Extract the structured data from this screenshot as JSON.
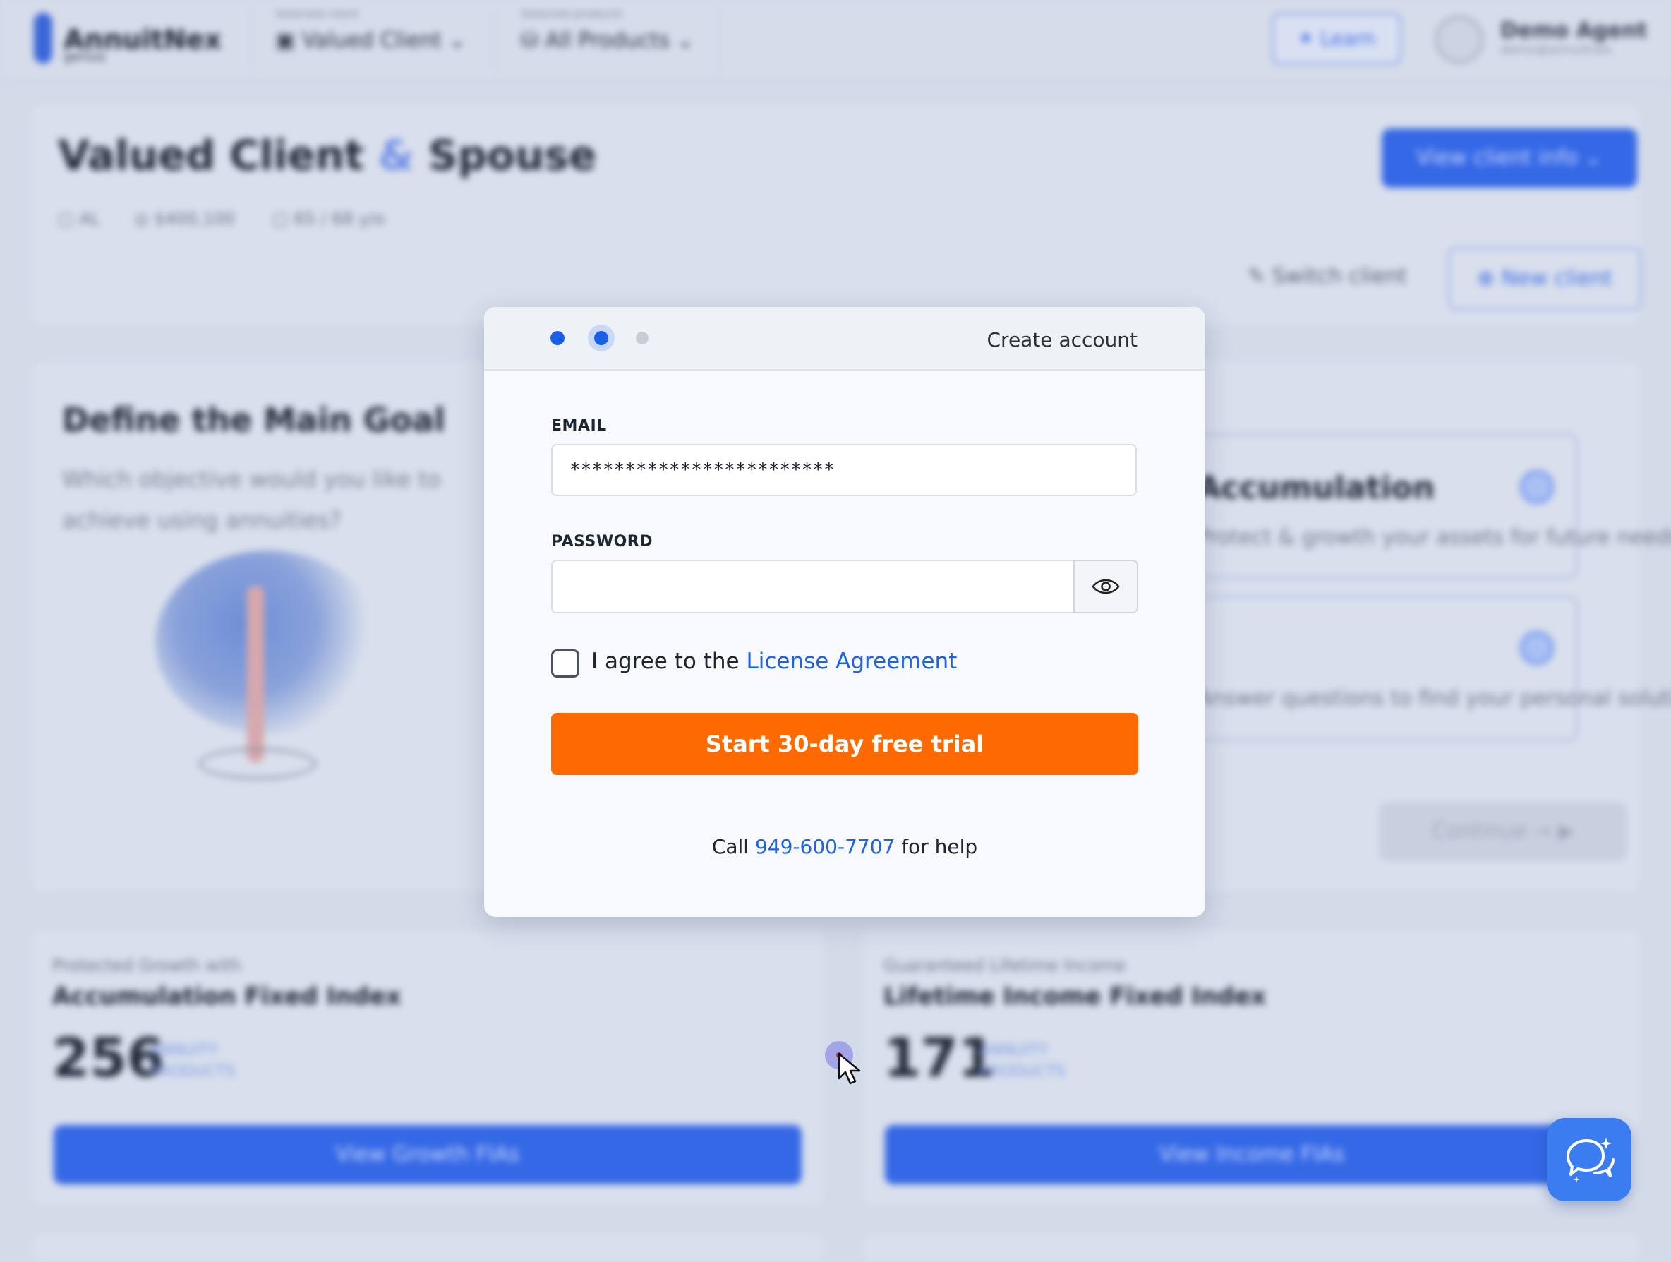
{
  "background": {
    "topbar": {
      "logo_text": "AnnuitNex",
      "logo_sub": "genius",
      "client_label": "Selected client",
      "client_value": "Valued Client",
      "product_label": "Selected products",
      "product_value": "All Products",
      "learn_label": "Learn",
      "agent_name": "Demo Agent",
      "agent_sub": "demo@annuitnex"
    },
    "client": {
      "name_first": "Valued Client",
      "name_amp": "&",
      "name_second": "Spouse",
      "state": "AL",
      "assets": "$400,100",
      "age": "65 / 68 y/o",
      "view_info_label": "View client info",
      "switch_label": "Switch client",
      "new_label": "New client"
    },
    "goal": {
      "title": "Define the Main Goal",
      "subtitle": "Which objective would you like to achieve using annuities?",
      "option1_title": "Accumulation",
      "option1_text": "Protect & growth your assets for future needs",
      "option2_text": "Answer questions to find your personal solution",
      "continue_label": "Continue"
    },
    "stats": [
      {
        "eyebrow": "Protected Growth with",
        "title": "Accumulation Fixed Index",
        "count": "256",
        "unit_line1": "ANNUITY",
        "unit_line2": "PRODUCTS",
        "button": "View Growth FIAs"
      },
      {
        "eyebrow": "Guaranteed Lifetime Income",
        "title": "Lifetime Income Fixed Index",
        "count": "171",
        "unit_line1": "ANNUITY",
        "unit_line2": "PRODUCTS",
        "button": "View Income FIAs"
      }
    ]
  },
  "modal": {
    "title": "Create account",
    "steps": 3,
    "current_step": 2,
    "email_label": "EMAIL",
    "email_value": "************************",
    "password_label": "PASSWORD",
    "password_value": "",
    "agree_prefix": "I agree to the ",
    "agree_link": "License Agreement",
    "agree_checked": false,
    "cta_label": "Start 30-day free trial",
    "help_prefix": "Call ",
    "help_phone": "949-600-7707",
    "help_suffix": " for help"
  },
  "colors": {
    "accent": "#1f63e0",
    "cta": "#ff6a00",
    "chat_fab": "#3b7cf0"
  },
  "icons": {
    "password_toggle": "eye-icon",
    "chat": "chat-icon"
  }
}
